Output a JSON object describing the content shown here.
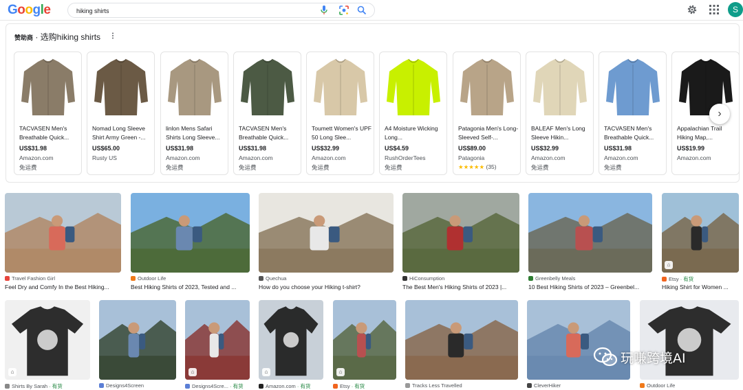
{
  "header": {
    "logo": "Google",
    "logo_colors": [
      "#4285F4",
      "#EA4335",
      "#FBBC05",
      "#4285F4",
      "#34A853",
      "#EA4335"
    ],
    "search_value": "hiking shirts",
    "avatar_letter": "S",
    "avatar_color": "#0f9d8a"
  },
  "sponsored": {
    "prefix": "赞助商",
    "title": " · 选购hiking shirts",
    "products": [
      {
        "name": "TACVASEN Men's Breathable Quick...",
        "price": "US$31.98",
        "store": "Amazon.com",
        "ship": "免运费",
        "shirt_color": "#8a7c68"
      },
      {
        "name": "Nomad Long Sleeve Shirt Army Green -...",
        "price": "US$65.00",
        "store": "Rusty US",
        "ship": "",
        "shirt_color": "#6b5a45"
      },
      {
        "name": "linlon Mens Safari Shirts Long Sleeve...",
        "price": "US$31.98",
        "store": "Amazon.com",
        "ship": "免运费",
        "shirt_color": "#a89880"
      },
      {
        "name": "TACVASEN Men's Breathable Quick...",
        "price": "US$31.98",
        "store": "Amazon.com",
        "ship": "免运费",
        "shirt_color": "#4c5a44"
      },
      {
        "name": "Toumett Women's UPF 50 Long Slee...",
        "price": "US$32.99",
        "store": "Amazon.com",
        "ship": "免运费",
        "shirt_color": "#d8c8a8"
      },
      {
        "name": "A4 Moisture Wicking Long...",
        "price": "US$4.59",
        "store": "RushOrderTees",
        "ship": "免运费",
        "shirt_color": "#c8f000"
      },
      {
        "name": "Patagonia Men's Long-Sleeved Self-...",
        "price": "US$89.00",
        "store": "Patagonia",
        "ship": "",
        "rating_stars": "★★★★★",
        "rating_count": "(35)",
        "shirt_color": "#b8a488"
      },
      {
        "name": "BALEAF Men's Long Sleeve Hikin...",
        "price": "US$32.99",
        "store": "Amazon.com",
        "ship": "免运费",
        "shirt_color": "#e0d6b8"
      },
      {
        "name": "TACVASEN Men's Breathable Quick...",
        "price": "US$31.98",
        "store": "Amazon.com",
        "ship": "免运费",
        "shirt_color": "#6e9bd0"
      },
      {
        "name": "Appalachian Trail Hiking Map,...",
        "price": "US$19.99",
        "store": "Amazon.com",
        "ship": "",
        "shirt_color": "#1a1a1a"
      }
    ]
  },
  "images_row1": [
    {
      "source": "Travel Fashion Girl",
      "caption": "Feel Dry and Comfy In the Best Hiking...",
      "fav_color": "#e8453c",
      "sky": "#b9c9d6",
      "ground": "#b08a68"
    },
    {
      "source": "Outdoor Life",
      "caption": "Best Hiking Shirts of 2023, Tested and ...",
      "fav_color": "#f07a1a",
      "sky": "#7ab0e0",
      "ground": "#4d6b3a"
    },
    {
      "source": "Quechua",
      "caption": "How do you choose your Hiking t-shirt?",
      "fav_color": "#555555",
      "sky": "#e8e6e0",
      "ground": "#8c7a60"
    },
    {
      "source": "HiConsumption",
      "caption": "The Best Men's Hiking Shirts of 2023 |...",
      "fav_color": "#333333",
      "sky": "#a0a8a0",
      "ground": "#5a6a40"
    },
    {
      "source": "Greenbelly Meals",
      "caption": "10 Best Hiking Shirts of 2023 – Greenbel...",
      "fav_color": "#2e7d32",
      "sky": "#8ab6e0",
      "ground": "#6b6b5a"
    },
    {
      "source": "Etsy",
      "instock": "· 有货",
      "caption": "Hiking Shirt for Women ...",
      "fav_color": "#f1641e",
      "sky": "#9fc0d8",
      "ground": "#7a6a50"
    }
  ],
  "images_row2": [
    {
      "source": "Shirts By Sarah",
      "instock": "· 有货",
      "fav_color": "#888888",
      "bg": "#f0f0f0"
    },
    {
      "source": "Designs4Screen",
      "fav_color": "#5b7fd6",
      "bg": "#3a4a38"
    },
    {
      "source": "Designs4Scre...",
      "instock": "· 有货",
      "fav_color": "#5b7fd6",
      "bg": "#8a3a38"
    },
    {
      "source": "Amazon.com",
      "instock": "· 有货",
      "fav_color": "#222222",
      "bg": "#c8d0d8"
    },
    {
      "source": "Etsy",
      "instock": "· 有货",
      "fav_color": "#f1641e",
      "bg": "#5a6a48"
    },
    {
      "source": "Tracks Less Travelled",
      "fav_color": "#999999",
      "bg": "#8a6a50"
    },
    {
      "source": "CleverHiker",
      "fav_color": "#444444",
      "bg": "#6a8ab0"
    },
    {
      "source": "Outdoor Life",
      "fav_color": "#f07a1a",
      "bg": "#e8eaee"
    }
  ],
  "watermark": "玩嗛跨境AI"
}
